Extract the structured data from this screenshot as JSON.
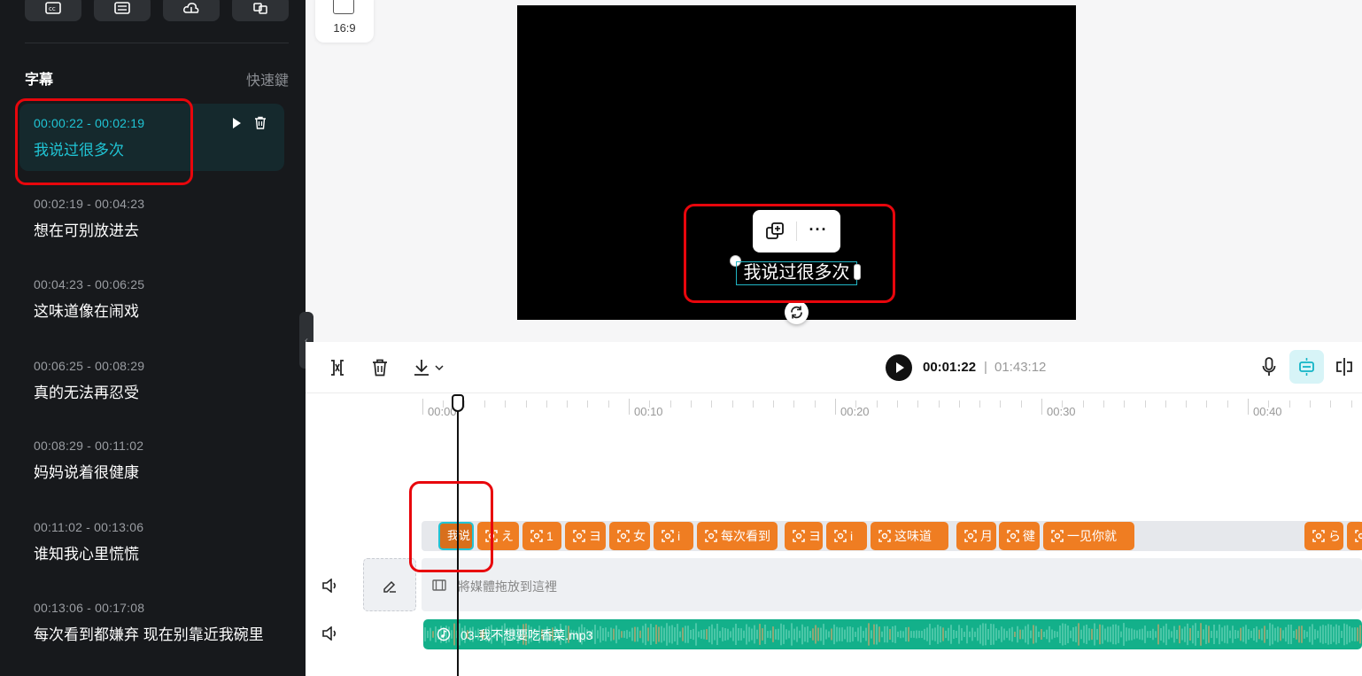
{
  "sidebar": {
    "title": "字幕",
    "shortcut_label": "快速鍵",
    "subtitles": [
      {
        "time": "00:00:22 - 00:02:19",
        "text": "我说过很多次",
        "active": true
      },
      {
        "time": "00:02:19 - 00:04:23",
        "text": "想在可别放进去"
      },
      {
        "time": "00:04:23 - 00:06:25",
        "text": "这味道像在闹戏"
      },
      {
        "time": "00:06:25 - 00:08:29",
        "text": "真的无法再忍受"
      },
      {
        "time": "00:08:29 - 00:11:02",
        "text": "妈妈说着很健康"
      },
      {
        "time": "00:11:02 - 00:13:06",
        "text": "谁知我心里慌慌"
      },
      {
        "time": "00:13:06 - 00:17:08",
        "text": "每次看到都嫌弃 现在别靠近我碗里"
      }
    ]
  },
  "preview": {
    "aspect_ratio": "16:9",
    "caption": "我说过很多次",
    "more_label": "···"
  },
  "timeline": {
    "current_time": "00:01:22",
    "separator": "|",
    "total_time": "01:43:12",
    "ruler_labels": [
      "00:00",
      "00:10",
      "00:20",
      "00:30",
      "00:40"
    ],
    "subtitle_clips": [
      {
        "label": "我说"
      },
      {
        "label": "え"
      },
      {
        "label": "1"
      },
      {
        "label": "ヨ"
      },
      {
        "label": "女"
      },
      {
        "label": "i"
      },
      {
        "label": "每次看到"
      },
      {
        "label": "ヨ"
      },
      {
        "label": "i"
      },
      {
        "label": "这味道"
      },
      {
        "label": "月"
      },
      {
        "label": "徤"
      },
      {
        "label": "一见你就"
      },
      {
        "label": "ら"
      },
      {
        "label": ""
      }
    ],
    "media_placeholder": "將媒體拖放到這裡",
    "audio_track": "03-我不想要吃香菜.mp3"
  },
  "colors": {
    "accent": "#20c4d4",
    "clip": "#ef7d22",
    "audio": "#13b08a",
    "annotation": "#e8060c"
  }
}
